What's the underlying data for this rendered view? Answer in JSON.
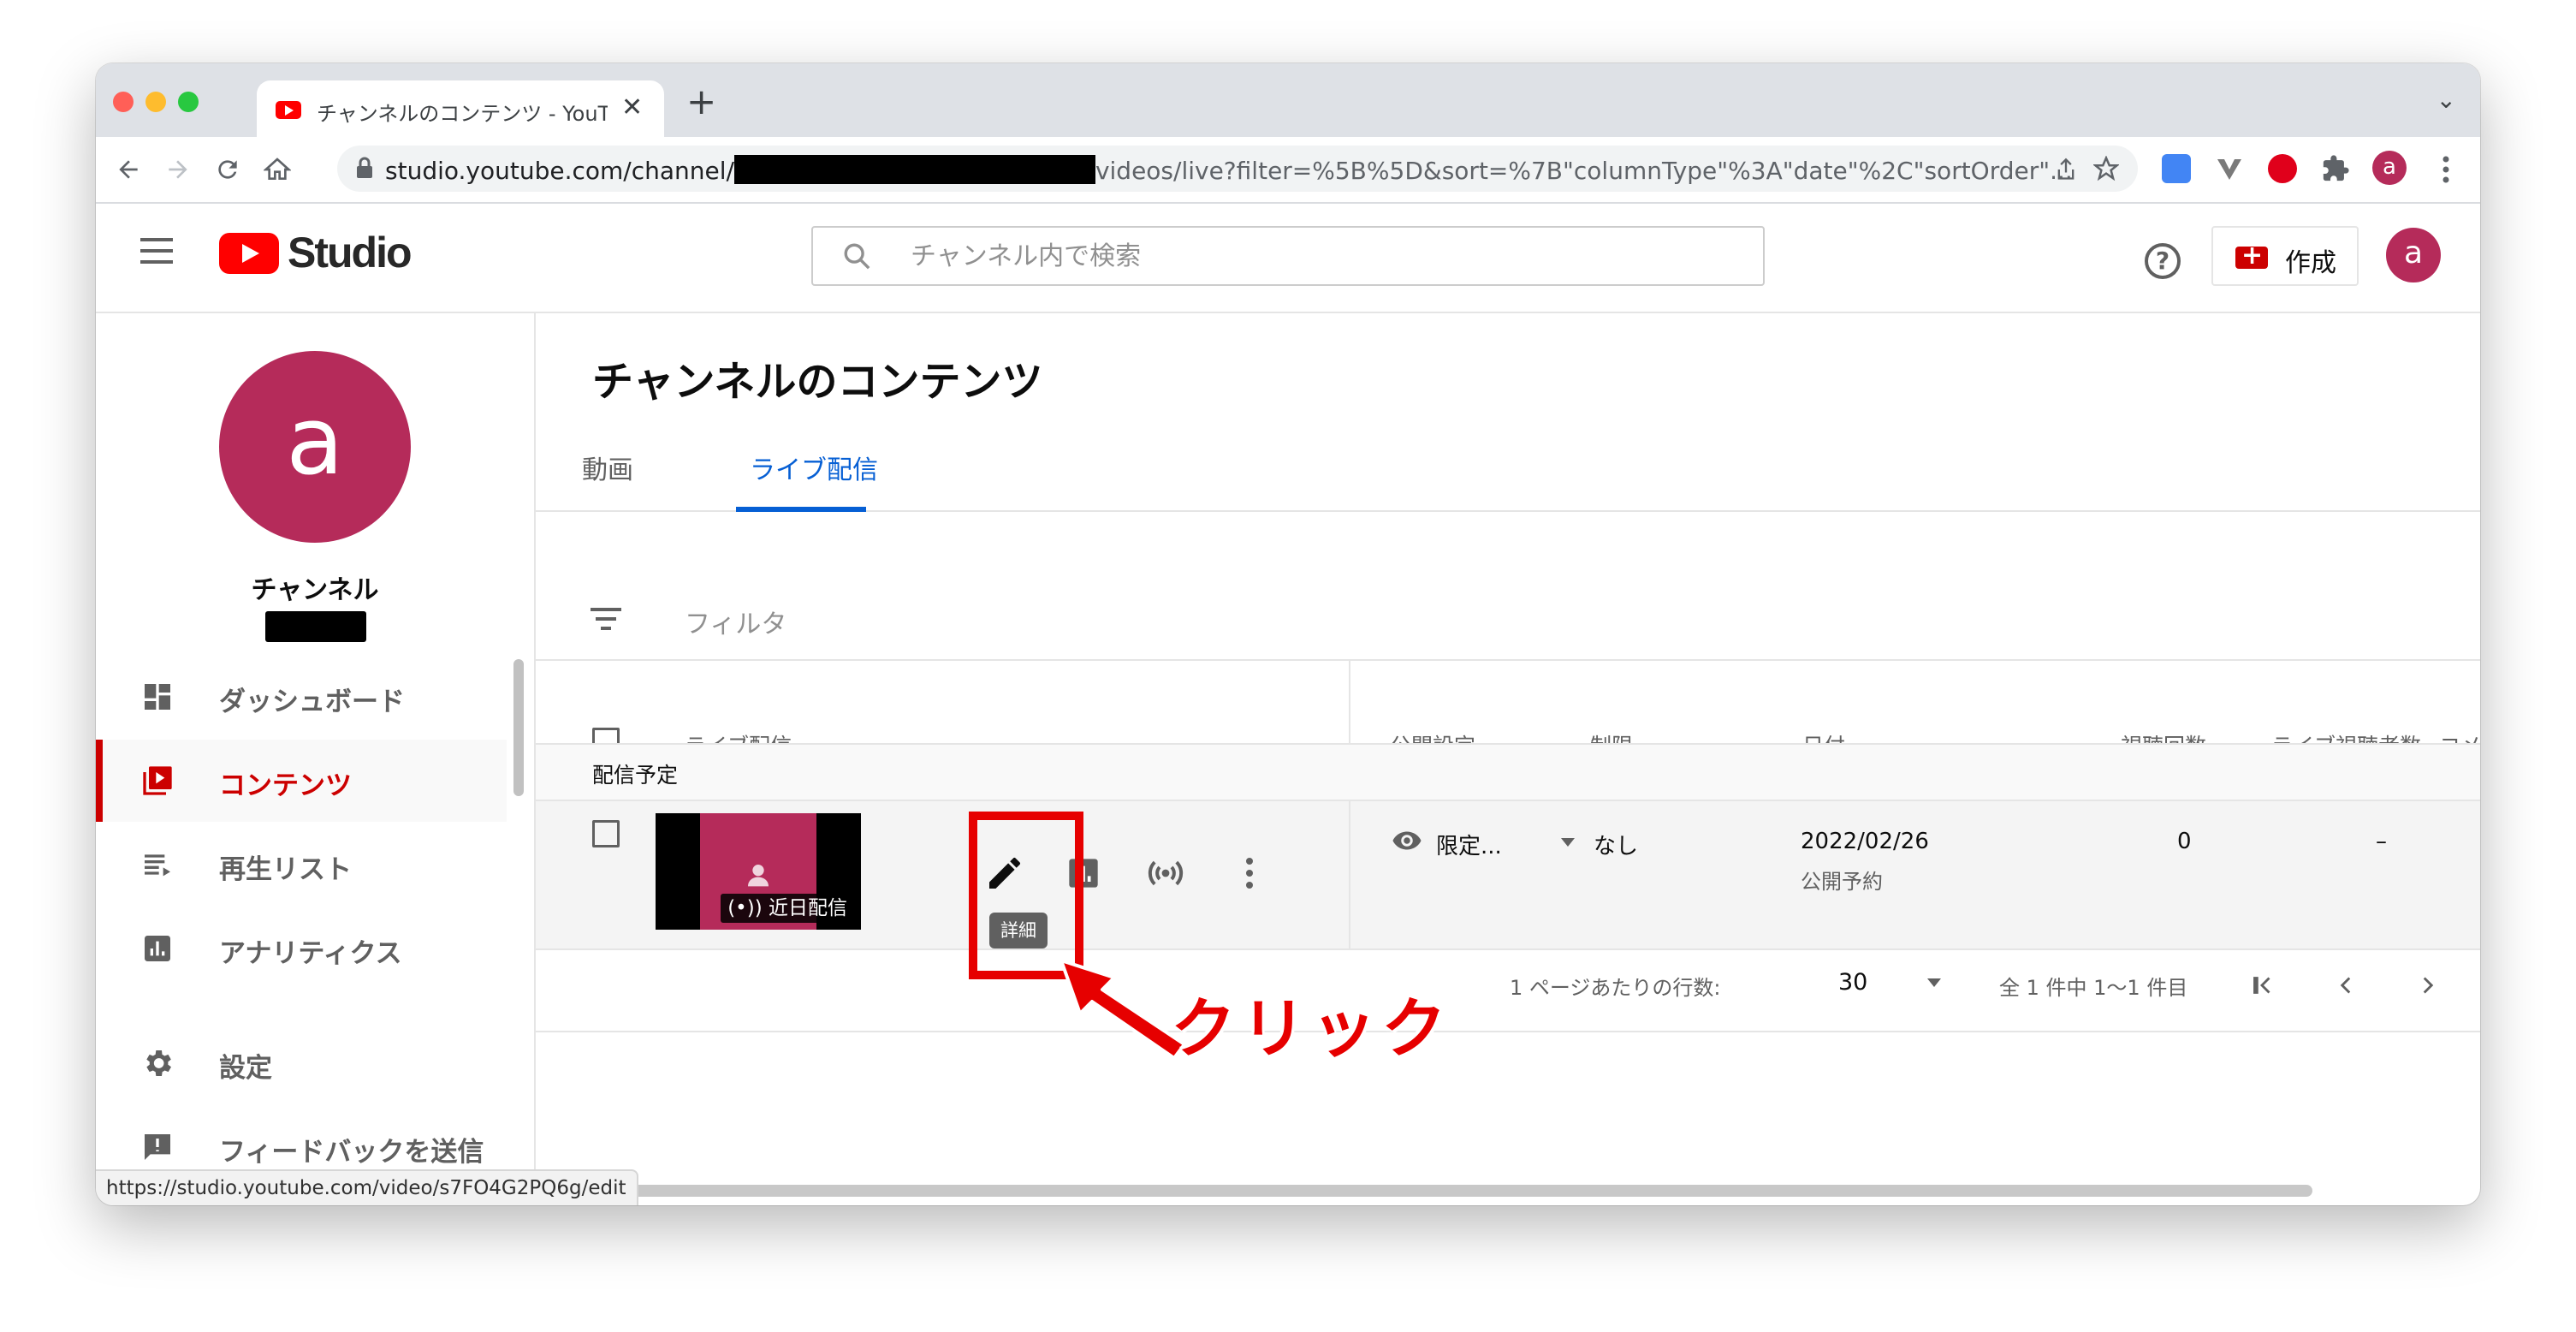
{
  "browser": {
    "tab_title": "チャンネルのコンテンツ - YouTube Studio",
    "url_prefix": "studio.youtube.com/channel/",
    "url_suffix": "videos/live?filter=%5B%5D&sort=%7B\"columnType\"%3A\"date\"%2C\"sortOrder\"...",
    "profile_initial": "a",
    "new_tab": "+",
    "close_tab": "✕",
    "tab_list": "⌄",
    "status_url": "https://studio.youtube.com/video/s7FO4G2PQ6g/edit"
  },
  "header": {
    "logo_text": "Studio",
    "search_placeholder": "チャンネル内で検索",
    "help": "?",
    "create_label": "作成",
    "avatar_initial": "a"
  },
  "sidebar": {
    "avatar_initial": "a",
    "channel_name": "チャンネル",
    "items": [
      {
        "label": "ダッシュボード",
        "icon": "dashboard-icon"
      },
      {
        "label": "コンテンツ",
        "icon": "content-icon",
        "active": true
      },
      {
        "label": "再生リスト",
        "icon": "playlist-icon"
      },
      {
        "label": "アナリティクス",
        "icon": "analytics-icon"
      },
      {
        "label": "設定",
        "icon": "gear-icon"
      },
      {
        "label": "フィードバックを送信",
        "icon": "feedback-icon"
      }
    ]
  },
  "main": {
    "title": "チャンネルのコンテンツ",
    "tabs": [
      {
        "label": "動画",
        "active": false
      },
      {
        "label": "ライブ配信",
        "active": true
      }
    ],
    "filter_label": "フィルタ",
    "columns": [
      "ライブ配信",
      "公開設定",
      "制限",
      "日付",
      "視聴回数",
      "ライブ視聴者数",
      "コメ"
    ],
    "section_label": "配信予定",
    "row": {
      "thumb_badge": "(•)) 近日配信",
      "visibility": "限定...",
      "restriction": "なし",
      "date": "2022/02/26",
      "date_status": "公開予約",
      "views": "0",
      "live_viewers": "–",
      "tooltip": "詳細"
    },
    "pager": {
      "rows_label": "1 ページあたりの行数:",
      "rows_value": "30",
      "range": "全 1 件中 1～1 件目",
      "first": "|<",
      "prev": "<",
      "next": ">",
      "last": ">|"
    }
  },
  "annotation": {
    "text": "クリック",
    "color": "#e60000"
  },
  "colors": {
    "brand_red": "#ff0000",
    "accent_blue": "#065fd4",
    "avatar": "#b52b5a",
    "active_nav": "#cc0000"
  }
}
